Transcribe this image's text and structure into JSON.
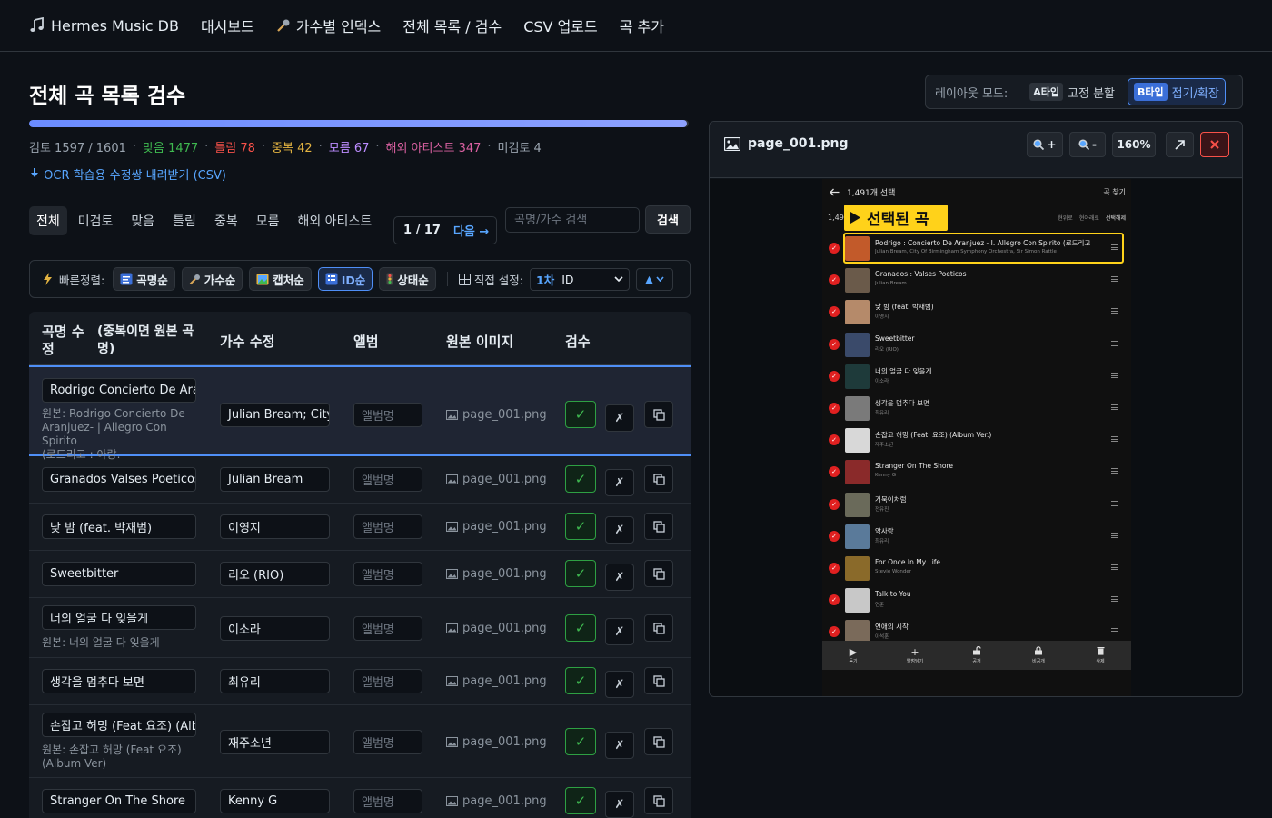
{
  "nav": {
    "brand": "Hermes Music DB",
    "links": [
      "대시보드",
      "가수별 인덱스",
      "전체 목록 / 검수",
      "CSV 업로드",
      "곡 추가"
    ]
  },
  "page": {
    "title": "전체 곡 목록 검수"
  },
  "layout_mode": {
    "label": "레이아웃 모드:",
    "a_tag": "A타입",
    "a_label": "고정 분할",
    "b_tag": "B타입",
    "b_label": "접기/확장",
    "active": "B"
  },
  "progress": {
    "reviewed": 1597,
    "total": 1601,
    "fraction": 0.9975
  },
  "stats": {
    "reviewed": "검토 1597 / 1601",
    "correct": "맞음 1477",
    "wrong": "틀림 78",
    "duplicate": "중복 42",
    "unknown": "모름 67",
    "foreign": "해외 아티스트 347",
    "unreviewed": "미검토 4"
  },
  "csv_link": "OCR 학습용 수정쌍 내려받기 (CSV)",
  "filters": {
    "tabs": [
      "전체",
      "미검토",
      "맞음",
      "틀림",
      "중복",
      "모름",
      "해외 아티스트"
    ],
    "active": 0,
    "pager_count": "1 / 17",
    "pager_next": "다음 →",
    "search_placeholder": "곡명/가수 검색",
    "search_button": "검색"
  },
  "sortbar": {
    "quick_label": "빠른정렬:",
    "buttons": [
      "곡명순",
      "가수순",
      "캡처순",
      "ID순",
      "상태순"
    ],
    "active": 3,
    "direct_label": "직접 설정:",
    "rank": "1차",
    "field": "ID",
    "order": "▲"
  },
  "table": {
    "headers": {
      "title_a": "곡명 수",
      "title_b": "정",
      "title_note_a": "(중복이면 원본 곡",
      "title_note_b": "명)",
      "artist": "가수 수정",
      "album": "앨범",
      "image": "원본 이미지",
      "review": "검수"
    },
    "album_placeholder": "앨범명",
    "rows": [
      {
        "title": "Rodrigo Concierto De Aranjuez",
        "orig_lines": [
          "원본: Rodrigo Concierto De",
          "Aranjuez- | Allegro Con Spirito",
          "(로드리고 : 아랑."
        ],
        "artist": "Julian Bream; City of Birmingham",
        "image": "page_001.png",
        "selected": true
      },
      {
        "title": "Granados Valses Poeticos",
        "orig_lines": [],
        "artist": "Julian Bream",
        "image": "page_001.png"
      },
      {
        "title": "낮 밤 (feat. 박재범)",
        "orig_lines": [],
        "artist": "이영지",
        "image": "page_001.png"
      },
      {
        "title": "Sweetbitter",
        "orig_lines": [],
        "artist": "리오 (RIO)",
        "image": "page_001.png"
      },
      {
        "title": "너의 얼굴 다 잊을게",
        "orig_lines": [
          "원본: 너의 얼굴 다 잊을게"
        ],
        "artist": "이소라",
        "image": "page_001.png"
      },
      {
        "title": "생각을 멈추다 보면",
        "orig_lines": [],
        "artist": "최유리",
        "image": "page_001.png"
      },
      {
        "title": "손잡고 허밍 (Feat 요조) (Album Ver)",
        "orig_lines": [
          "원본: 손잡고 허망 (Feat 요조)",
          "(Album Ver)"
        ],
        "artist": "재주소년",
        "image": "page_001.png"
      },
      {
        "title": "Stranger On The Shore",
        "orig_lines": [],
        "artist": "Kenny G",
        "image": "page_001.png"
      }
    ]
  },
  "viewer": {
    "filename": "page_001.png",
    "zoom_in": "+",
    "zoom_out": "-",
    "zoom": "160%"
  },
  "phone": {
    "header": "1,491개 선택",
    "find": "곡 찾기",
    "count": "1,49",
    "badge": "선택된 곡",
    "actions": [
      "현위로",
      "현아래로",
      "선택해제"
    ],
    "items": [
      {
        "title": "Rodrigo : Concierto De Aranjuez - I. Allegro Con Spirito (로드리고 : 아랑...",
        "artist": "Julian Bream, City Of Birmingham Symphony Orchestra, Sir Simon Rattle",
        "color": "#c25a2a",
        "selected": true
      },
      {
        "title": "Granados : Valses Poeticos",
        "artist": "Julian Bream",
        "color": "#6a5a4a"
      },
      {
        "title": "낮 밤 (feat. 박재범)",
        "artist": "이영지",
        "color": "#b58a6a"
      },
      {
        "title": "Sweetbitter",
        "artist": "리오 (RIO)",
        "color": "#3a4a6a"
      },
      {
        "title": "너의 얼굴 다 잊을게",
        "artist": "이소라",
        "color": "#1e3a3a"
      },
      {
        "title": "생각을 멈추다 보면",
        "artist": "최유리",
        "color": "#7a7a7a"
      },
      {
        "title": "손잡고 허밍 (Feat. 요조) (Album Ver.)",
        "artist": "재주소년",
        "color": "#d8d8d8"
      },
      {
        "title": "Stranger On The Shore",
        "artist": "Kenny G",
        "color": "#8a2a2a"
      },
      {
        "title": "거북이처럼",
        "artist": "전유진",
        "color": "#6a6a5a"
      },
      {
        "title": "악사랑",
        "artist": "최유리",
        "color": "#5a7a9a"
      },
      {
        "title": "For Once In My Life",
        "artist": "Stevie Wonder",
        "color": "#8a6a2a"
      },
      {
        "title": "Talk to You",
        "artist": "연준",
        "color": "#c8c8c8"
      },
      {
        "title": "연애의 시작",
        "artist": "이석훈",
        "color": "#7a6a5a"
      }
    ],
    "bottom": [
      "듣기",
      "앨범담기",
      "공개",
      "비공개",
      "삭제"
    ]
  }
}
